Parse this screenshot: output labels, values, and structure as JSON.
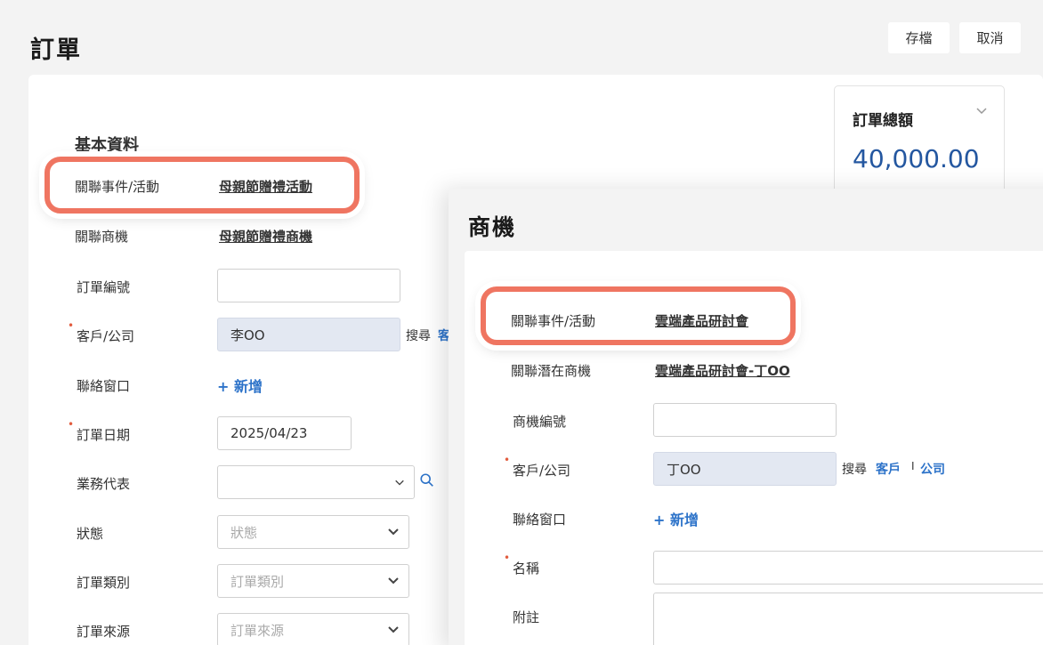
{
  "header": {
    "title": "訂單",
    "save_label": "存檔",
    "cancel_label": "取消"
  },
  "order": {
    "section_title": "基本資料",
    "related_event_label": "關聯事件/活動",
    "related_event_value": "母親節贈禮活動",
    "related_opp_label": "關聯商機",
    "related_opp_value": "母親節贈禮商機",
    "order_no_label": "訂單編號",
    "order_no_value": "",
    "customer_label": "客戶/公司",
    "customer_value": "李OO",
    "customer_search": "搜尋",
    "customer_search_link": "客",
    "contact_label": "聯絡窗口",
    "add_label": "新增",
    "date_label": "訂單日期",
    "date_value": "2025/04/23",
    "rep_label": "業務代表",
    "status_label": "狀態",
    "status_placeholder": "狀態",
    "type_label": "訂單類別",
    "type_placeholder": "訂單類別",
    "source_label": "訂單來源",
    "source_placeholder": "訂單來源"
  },
  "total": {
    "label": "訂單總額",
    "value": "40,000.00"
  },
  "opportunity": {
    "title": "商機",
    "related_event_label": "關聯事件/活動",
    "related_event_value": "雲端產品研討會",
    "related_lead_label": "關聯潛在商機",
    "related_lead_value": "雲端產品研討會-丁OO",
    "opp_no_label": "商機編號",
    "customer_label": "客戶/公司",
    "customer_value": "丁OO",
    "search_label": "搜尋",
    "customer_link": "客戶",
    "separator": "I",
    "company_link": "公司",
    "contact_label": "聯絡窗口",
    "add_label": "新增",
    "name_label": "名稱",
    "note_label": "附註"
  },
  "colors": {
    "accent": "#2d73c9",
    "highlight": "#ef7561",
    "required": "#e25c3e",
    "total": "#2457a0"
  },
  "icons": [
    "chevron-down-icon",
    "search-icon",
    "plus-icon"
  ]
}
